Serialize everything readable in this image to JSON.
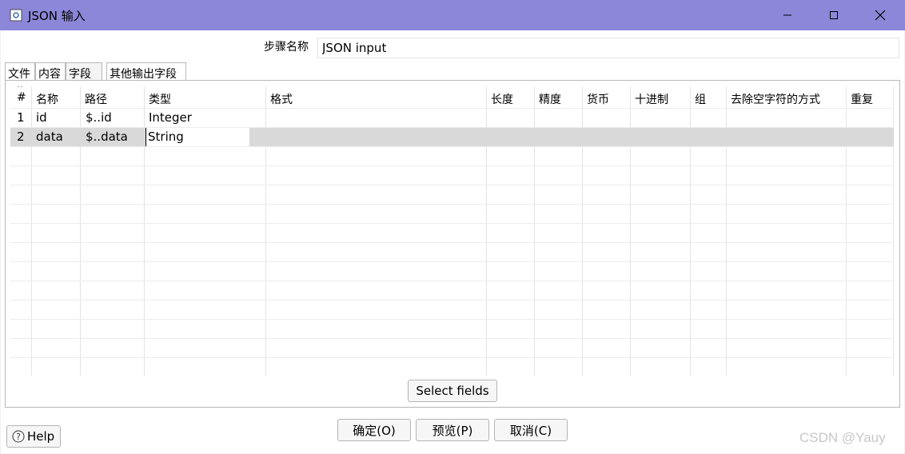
{
  "window": {
    "title": "JSON 输入"
  },
  "step": {
    "label": "步骤名称",
    "value": "JSON input"
  },
  "tabs": [
    "文件",
    "内容",
    "字段",
    "其他输出字段"
  ],
  "table": {
    "headers": [
      "#",
      "名称",
      "路径",
      "类型",
      "格式",
      "长度",
      "精度",
      "货币",
      "十进制",
      "组",
      "去除空字符的方式",
      "重复"
    ],
    "rows": [
      {
        "num": "1",
        "name": "id",
        "path": "$..id",
        "type": "Integer"
      },
      {
        "num": "2",
        "name": "data",
        "path": "$..data",
        "type": "String"
      }
    ]
  },
  "buttons": {
    "select_fields": "Select fields",
    "help": "Help",
    "ok": "确定(O)",
    "preview": "预览(P)",
    "cancel": "取消(C)"
  },
  "watermark": "CSDN @Yauy"
}
